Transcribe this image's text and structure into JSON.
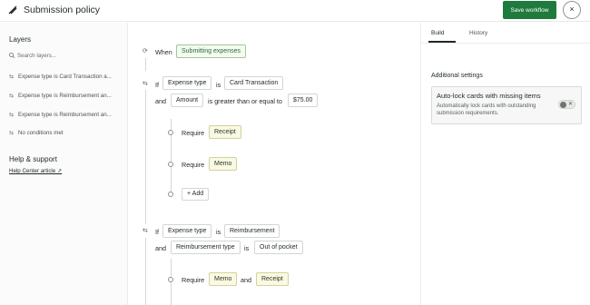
{
  "header": {
    "title": "Submission policy",
    "save_label": "Save workflow",
    "close_label": "×"
  },
  "sidebar": {
    "layers_heading": "Layers",
    "search_placeholder": "Search layers...",
    "items": [
      {
        "label": "Expense type is Card Transaction a..."
      },
      {
        "label": "Expense type is Reimbursement an..."
      },
      {
        "label": "Expense type is Reimbursement an..."
      },
      {
        "label": "No conditions met"
      }
    ],
    "help_heading": "Help & support",
    "help_link": "Help Center article ↗"
  },
  "canvas": {
    "when_label": "When",
    "trigger": "Submitting expenses",
    "rule1": {
      "if_label": "If",
      "field": "Expense type",
      "op": "is",
      "value": "Card Transaction",
      "and_label": "and",
      "field2": "Amount",
      "op2": "is greater than or equal to",
      "value2": "$75.00",
      "require_label": "Require",
      "req1": "Receipt",
      "req2": "Memo",
      "add_label": "+ Add"
    },
    "rule2": {
      "if_label": "If",
      "field": "Expense type",
      "op": "is",
      "value": "Reimbursement",
      "and_label": "and",
      "field2": "Reimbursement type",
      "op2": "is",
      "value2": "Out of pocket",
      "require_label": "Require",
      "req1": "Memo",
      "and2": "and",
      "req2": "Receipt"
    }
  },
  "right_panel": {
    "tabs": [
      {
        "label": "Build"
      },
      {
        "label": "History"
      }
    ],
    "active_tab": "Build",
    "section_title": "Additional settings",
    "setting": {
      "title": "Auto-lock cards with missing items",
      "description": "Automatically lock cards with outstanding submission requirements.",
      "toggle_state": "off"
    }
  },
  "colors": {
    "primary": "#1f7a3d",
    "trigger_chip": "#f5fbf1",
    "requirement_chip": "#fbf9e3"
  }
}
